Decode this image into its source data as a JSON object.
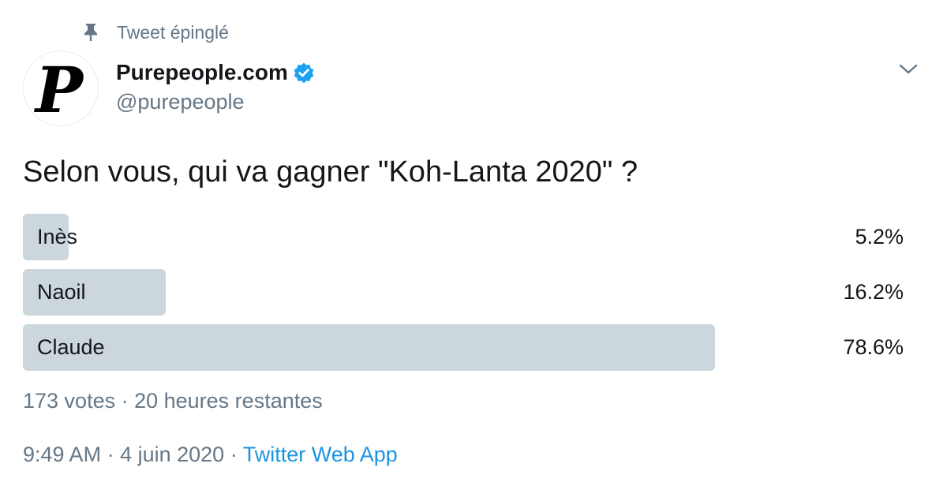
{
  "pinned": {
    "label": "Tweet épinglé",
    "icon": "pin-icon"
  },
  "author": {
    "avatar_letter": "P",
    "display_name": "Purepeople.com",
    "verified": true,
    "verified_color": "#1da1f2",
    "handle": "@purepeople"
  },
  "menu": {
    "icon": "chevron-down-icon"
  },
  "tweet": {
    "text": "Selon vous, qui va gagner \"Koh-Lanta 2020\" ?"
  },
  "poll": {
    "bar_color": "#ccd6dd",
    "options": [
      {
        "label": "Inès",
        "percent_text": "5.2%",
        "percent": 5.2
      },
      {
        "label": "Naoil",
        "percent_text": "16.2%",
        "percent": 16.2
      },
      {
        "label": "Claude",
        "percent_text": "78.6%",
        "percent": 78.6
      }
    ],
    "votes": "173 votes",
    "separator": " · ",
    "time_left": "20 heures restantes"
  },
  "meta": {
    "time": "9:49 AM",
    "separator": " · ",
    "date": "4 juin 2020",
    "source": "Twitter Web App",
    "source_color": "#1b95e0"
  }
}
